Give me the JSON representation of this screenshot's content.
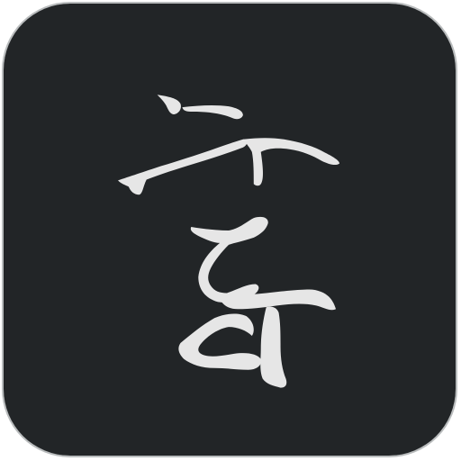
{
  "icon": {
    "name": "calligraphy-character-app-icon",
    "glyph": "字",
    "background_color": "#222527",
    "glyph_color": "#e6e6e6",
    "border_color": "#b9bcbd"
  }
}
